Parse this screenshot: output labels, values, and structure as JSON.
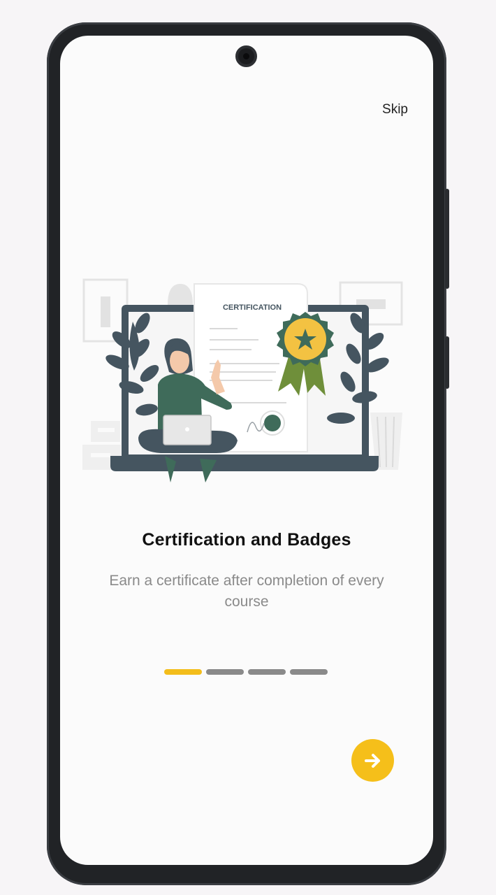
{
  "onboarding": {
    "skip_label": "Skip",
    "title": "Certification and Badges",
    "subtitle": "Earn a certificate after completion of every course",
    "illustration_text": "CERTIFICATION",
    "pages_total": 4,
    "current_page": 1,
    "next_icon": "arrow-right-icon"
  },
  "colors": {
    "accent": "#f3bd1b",
    "inactive_dot": "#8a8a8a",
    "illustration_dark": "#455560",
    "illustration_green": "#3f6b5a"
  }
}
